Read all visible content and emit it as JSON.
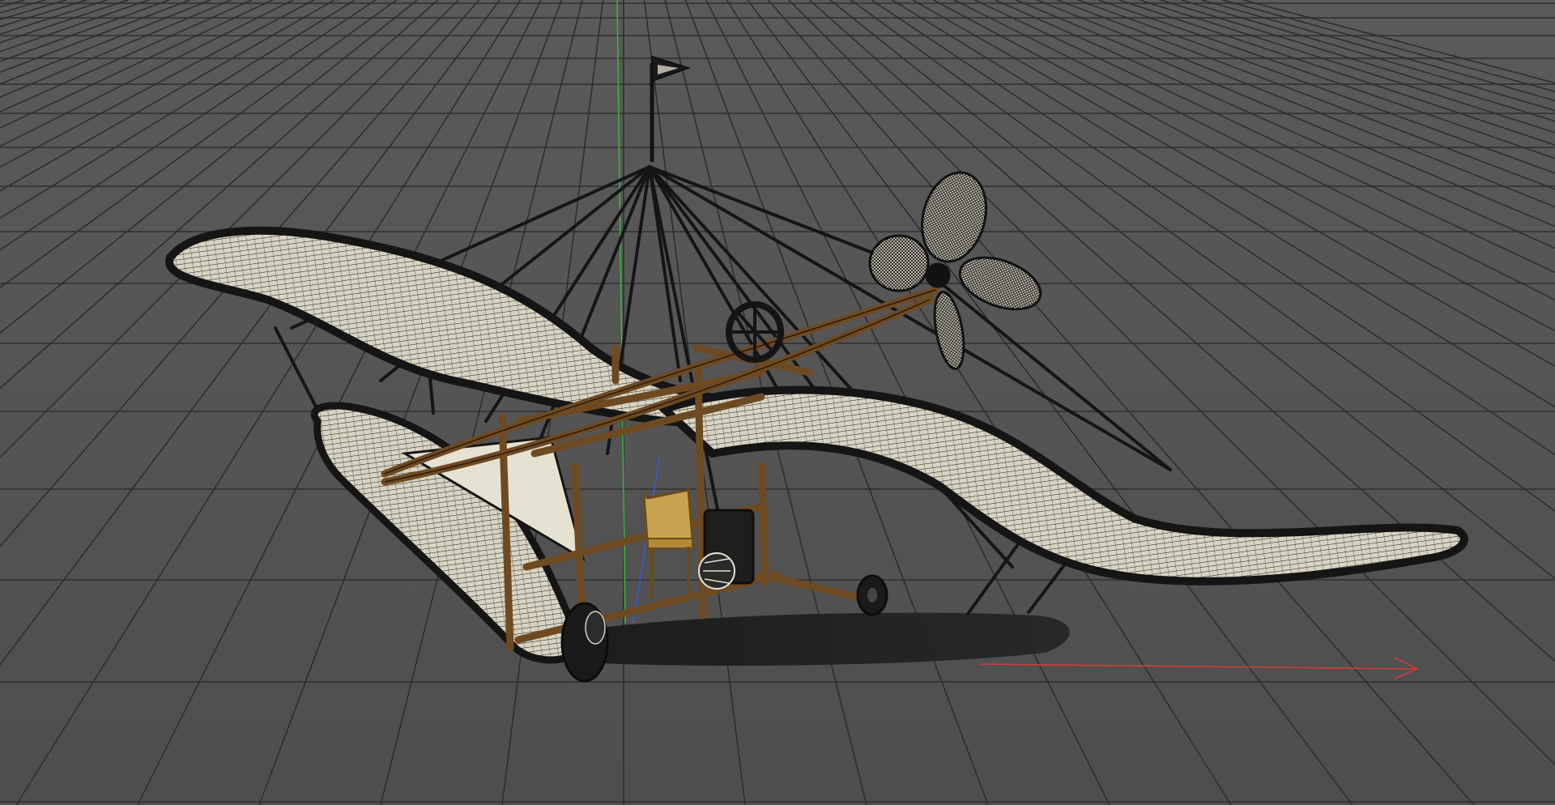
{
  "viewport": {
    "background_color": "#555555",
    "grid_color": "#2e2e2e",
    "wing_fill_color": "#d8d4c2",
    "wing_wire_color": "#1c1c1c",
    "frame_wood_color": "#6e4a22",
    "seat_color": "#c9a250",
    "x_axis_color": "#d23c3c",
    "y_axis_color": "#3cb83c",
    "z_axis_color": "#3c5ad2"
  },
  "scene": {
    "object": "airplane-model",
    "display_mode": "wireframe-shaded",
    "axes": [
      "x-axis",
      "y-axis",
      "z-axis"
    ],
    "icons": [
      "flag-icon"
    ]
  }
}
